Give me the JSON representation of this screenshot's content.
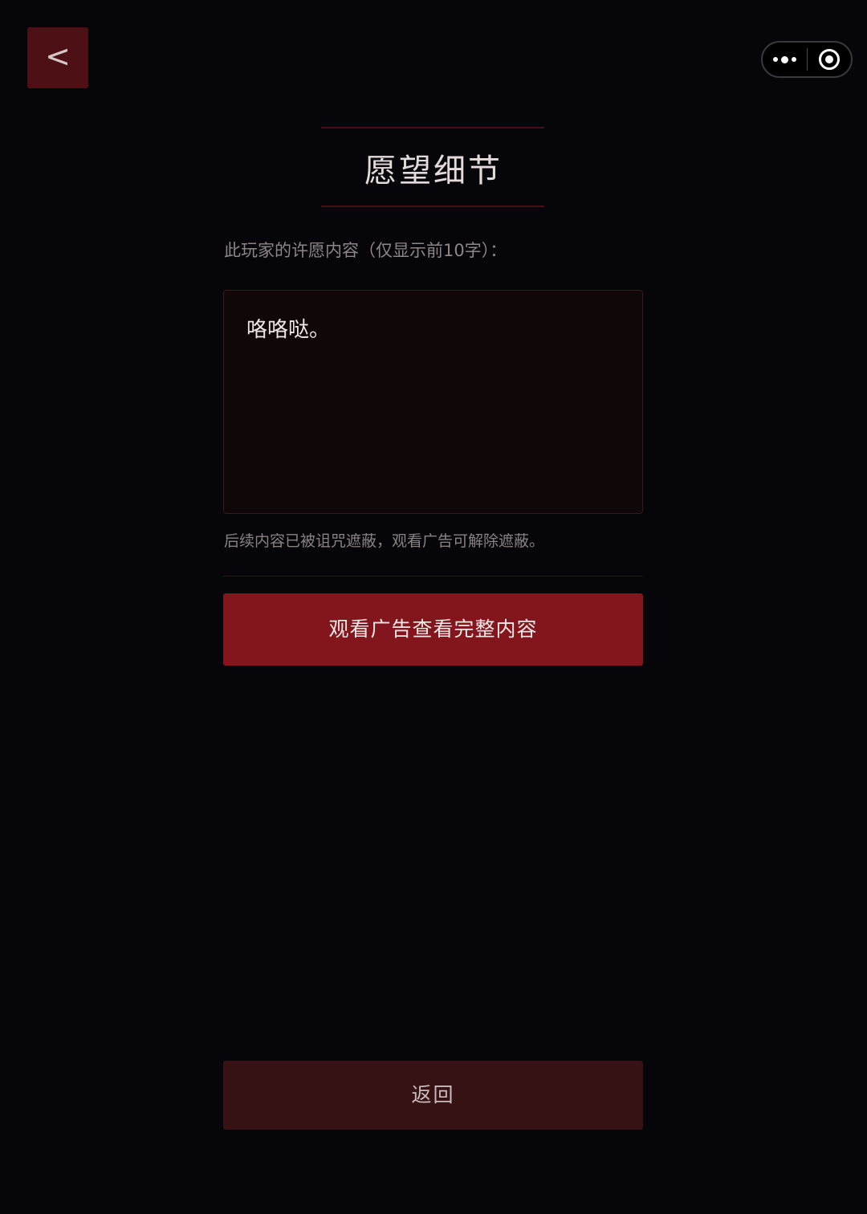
{
  "nav": {
    "back_label": "<"
  },
  "capsule": {
    "more_icon": "more-dots-icon",
    "close_icon": "target-circle-icon"
  },
  "header": {
    "title": "愿望细节"
  },
  "wish": {
    "label": "此玩家的许愿内容（仅显示前10字）：",
    "content": "咯咯哒。",
    "hint": "后续内容已被诅咒遮蔽，观看广告可解除遮蔽。"
  },
  "actions": {
    "watch_ad_label": "观看广告查看完整内容",
    "return_label": "返回"
  },
  "colors": {
    "background": "#06050a",
    "accent": "#83161c",
    "back_button": "#4d1015",
    "return_button": "#361214"
  }
}
